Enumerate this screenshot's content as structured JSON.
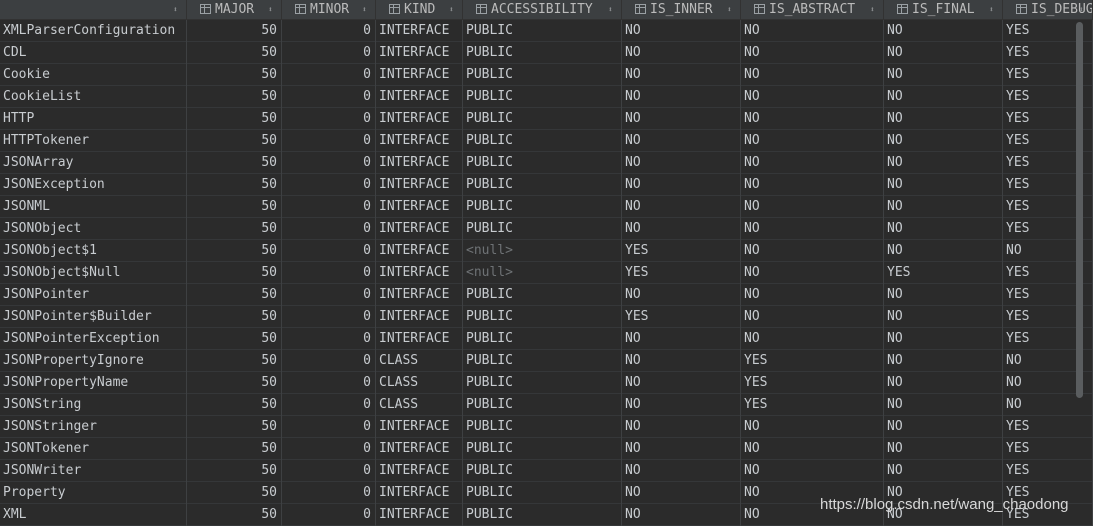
{
  "columns": [
    {
      "label": ""
    },
    {
      "label": "MAJOR"
    },
    {
      "label": "MINOR"
    },
    {
      "label": "KIND"
    },
    {
      "label": "ACCESSIBILITY"
    },
    {
      "label": "IS_INNER"
    },
    {
      "label": "IS_ABSTRACT"
    },
    {
      "label": "IS_FINAL"
    },
    {
      "label": "IS_DEBUG"
    }
  ],
  "rows": [
    [
      "XMLParserConfiguration",
      "50",
      "0",
      "INTERFACE",
      "PUBLIC",
      "NO",
      "NO",
      "NO",
      "YES"
    ],
    [
      "CDL",
      "50",
      "0",
      "INTERFACE",
      "PUBLIC",
      "NO",
      "NO",
      "NO",
      "YES"
    ],
    [
      "Cookie",
      "50",
      "0",
      "INTERFACE",
      "PUBLIC",
      "NO",
      "NO",
      "NO",
      "YES"
    ],
    [
      "CookieList",
      "50",
      "0",
      "INTERFACE",
      "PUBLIC",
      "NO",
      "NO",
      "NO",
      "YES"
    ],
    [
      "HTTP",
      "50",
      "0",
      "INTERFACE",
      "PUBLIC",
      "NO",
      "NO",
      "NO",
      "YES"
    ],
    [
      "HTTPTokener",
      "50",
      "0",
      "INTERFACE",
      "PUBLIC",
      "NO",
      "NO",
      "NO",
      "YES"
    ],
    [
      "JSONArray",
      "50",
      "0",
      "INTERFACE",
      "PUBLIC",
      "NO",
      "NO",
      "NO",
      "YES"
    ],
    [
      "JSONException",
      "50",
      "0",
      "INTERFACE",
      "PUBLIC",
      "NO",
      "NO",
      "NO",
      "YES"
    ],
    [
      "JSONML",
      "50",
      "0",
      "INTERFACE",
      "PUBLIC",
      "NO",
      "NO",
      "NO",
      "YES"
    ],
    [
      "JSONObject",
      "50",
      "0",
      "INTERFACE",
      "PUBLIC",
      "NO",
      "NO",
      "NO",
      "YES"
    ],
    [
      "JSONObject$1",
      "50",
      "0",
      "INTERFACE",
      "<null>",
      "YES",
      "NO",
      "NO",
      "NO"
    ],
    [
      "JSONObject$Null",
      "50",
      "0",
      "INTERFACE",
      "<null>",
      "YES",
      "NO",
      "YES",
      "YES"
    ],
    [
      "JSONPointer",
      "50",
      "0",
      "INTERFACE",
      "PUBLIC",
      "NO",
      "NO",
      "NO",
      "YES"
    ],
    [
      "JSONPointer$Builder",
      "50",
      "0",
      "INTERFACE",
      "PUBLIC",
      "YES",
      "NO",
      "NO",
      "YES"
    ],
    [
      "JSONPointerException",
      "50",
      "0",
      "INTERFACE",
      "PUBLIC",
      "NO",
      "NO",
      "NO",
      "YES"
    ],
    [
      "JSONPropertyIgnore",
      "50",
      "0",
      "CLASS",
      "PUBLIC",
      "NO",
      "YES",
      "NO",
      "NO"
    ],
    [
      "JSONPropertyName",
      "50",
      "0",
      "CLASS",
      "PUBLIC",
      "NO",
      "YES",
      "NO",
      "NO"
    ],
    [
      "JSONString",
      "50",
      "0",
      "CLASS",
      "PUBLIC",
      "NO",
      "YES",
      "NO",
      "NO"
    ],
    [
      "JSONStringer",
      "50",
      "0",
      "INTERFACE",
      "PUBLIC",
      "NO",
      "NO",
      "NO",
      "YES"
    ],
    [
      "JSONTokener",
      "50",
      "0",
      "INTERFACE",
      "PUBLIC",
      "NO",
      "NO",
      "NO",
      "YES"
    ],
    [
      "JSONWriter",
      "50",
      "0",
      "INTERFACE",
      "PUBLIC",
      "NO",
      "NO",
      "NO",
      "YES"
    ],
    [
      "Property",
      "50",
      "0",
      "INTERFACE",
      "PUBLIC",
      "NO",
      "NO",
      "NO",
      "YES"
    ],
    [
      "XML",
      "50",
      "0",
      "INTERFACE",
      "PUBLIC",
      "NO",
      "NO",
      "NO",
      "YES"
    ]
  ],
  "null_text": "<null>",
  "watermark": "https://blog.csdn.net/wang_chaodong",
  "colors": {
    "background": "#2b2b2b",
    "header_background": "#3c3f41",
    "cell_text": "#c8ccd0",
    "null_text": "#6e7275",
    "grid_line": "#3e4042"
  },
  "icons": {
    "column_header": "table-column-icon",
    "sort": "sort-arrows-icon"
  }
}
